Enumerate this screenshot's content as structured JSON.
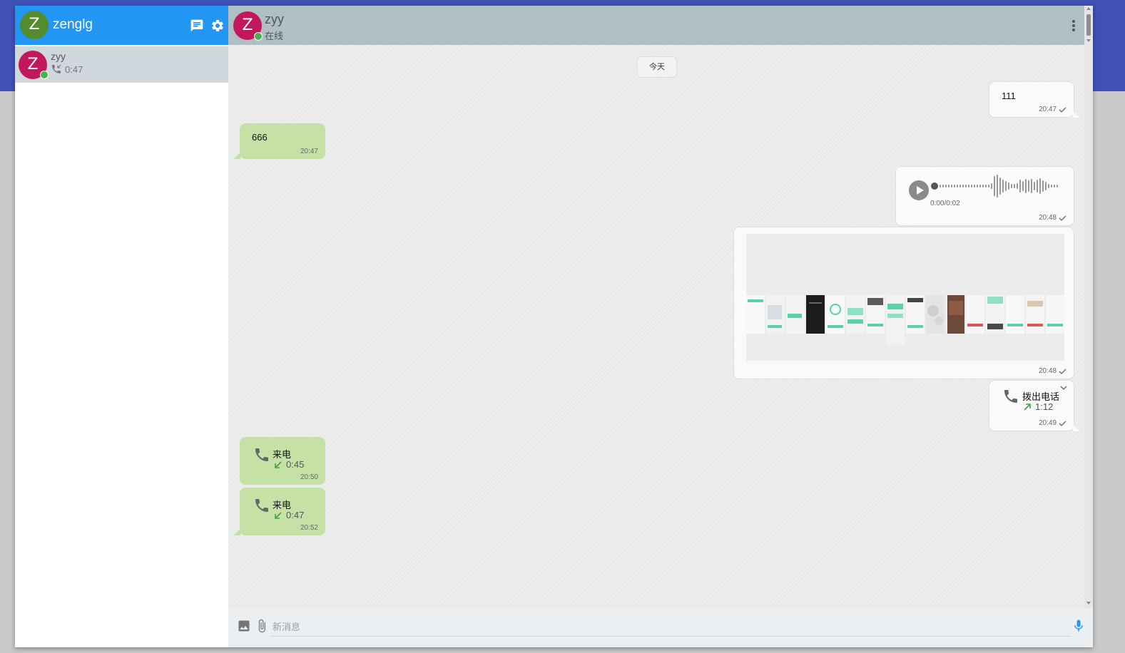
{
  "user": {
    "initial": "Z",
    "name": "zenglg",
    "avatar_color": "#558b2f"
  },
  "sidebar": {
    "header_color": "#2196f3",
    "icons": [
      "new-chat-icon",
      "settings-icon"
    ],
    "contacts": [
      {
        "initial": "Z",
        "name": "zyy",
        "last": "0:47",
        "last_icon": "incoming-call-icon",
        "avatar_color": "#c2185b",
        "online": true
      }
    ]
  },
  "chat": {
    "peer": {
      "initial": "Z",
      "name": "zyy",
      "status": "在线"
    },
    "date_chip": "今天",
    "messages": [
      {
        "dir": "out",
        "kind": "text",
        "text": "111",
        "time": "20:47"
      },
      {
        "dir": "in",
        "kind": "text",
        "text": "666",
        "time": "20:47"
      },
      {
        "dir": "out",
        "kind": "voice",
        "duration": "0:00/0:02",
        "time": "20:48"
      },
      {
        "dir": "out",
        "kind": "image",
        "time": "20:48"
      },
      {
        "dir": "out",
        "kind": "call",
        "label": "拨出电话",
        "duration": "1:12",
        "time": "20:49"
      },
      {
        "dir": "in",
        "kind": "call",
        "label": "来电",
        "duration": "0:45",
        "time": "20:50"
      },
      {
        "dir": "in",
        "kind": "call",
        "label": "来电",
        "duration": "0:47",
        "time": "20:52"
      }
    ]
  },
  "composer": {
    "placeholder": "新消息",
    "icons": [
      "image-icon",
      "attach-icon",
      "mic-icon"
    ]
  },
  "colors": {
    "accent": "#2196f3",
    "topband": "#3f51b5",
    "in_bubble": "#c5e1a5",
    "call_green": "#43a047"
  }
}
